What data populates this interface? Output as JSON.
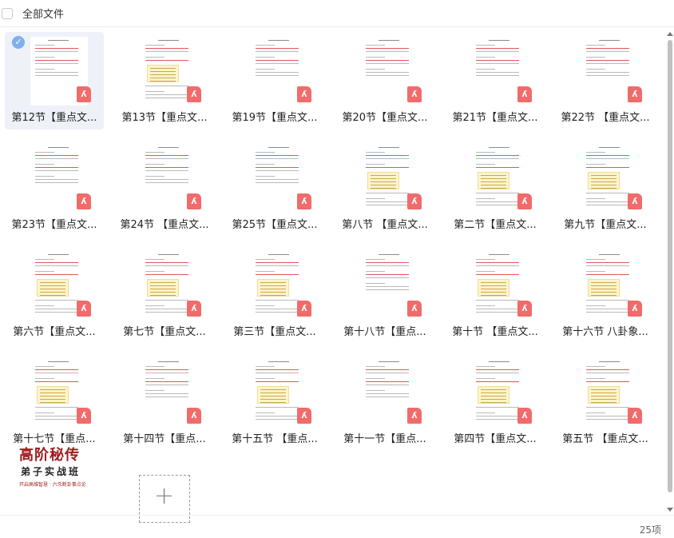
{
  "header": {
    "title": "全部文件"
  },
  "files": [
    {
      "label": "第12节【重点文...",
      "selected": true,
      "table": false
    },
    {
      "label": "第13节【重点文...",
      "selected": false,
      "table": true
    },
    {
      "label": "第19节【重点文...",
      "selected": false,
      "table": false
    },
    {
      "label": "第20节【重点文...",
      "selected": false,
      "table": false
    },
    {
      "label": "第21节【重点文...",
      "selected": false,
      "table": false
    },
    {
      "label": "第22节 【重点文...",
      "selected": false,
      "table": false
    },
    {
      "label": "第23节【重点文...",
      "selected": false,
      "table": false
    },
    {
      "label": "第24节 【重点文...",
      "selected": false,
      "table": false
    },
    {
      "label": "第25节【重点文...",
      "selected": false,
      "table": false
    },
    {
      "label": "第八节 【重点文...",
      "selected": false,
      "table": true
    },
    {
      "label": "第二节【重点文...",
      "selected": false,
      "table": true
    },
    {
      "label": "第九节【重点文...",
      "selected": false,
      "table": true
    },
    {
      "label": "第六节【重点文...",
      "selected": false,
      "table": true
    },
    {
      "label": "第七节【重点文...",
      "selected": false,
      "table": true
    },
    {
      "label": "第三节【重点文...",
      "selected": false,
      "table": true
    },
    {
      "label": "第十八节【重点...",
      "selected": false,
      "table": false
    },
    {
      "label": "第十节 【重点文...",
      "selected": false,
      "table": true
    },
    {
      "label": "第十六节 八卦象...",
      "selected": false,
      "table": true
    },
    {
      "label": "第十七节【重点...",
      "selected": false,
      "table": true
    },
    {
      "label": "第十四节【重点...",
      "selected": false,
      "table": false
    },
    {
      "label": "第十五节 【重点...",
      "selected": false,
      "table": true
    },
    {
      "label": "第十一节【重点...",
      "selected": false,
      "table": false
    },
    {
      "label": "第四节【重点文...",
      "selected": false,
      "table": true
    },
    {
      "label": "第五节 【重点文...",
      "selected": false,
      "table": true
    }
  ],
  "ad": {
    "title": "高阶秘传",
    "subtitle": "弟子实战班",
    "tagline": "开启高维智慧 · 六爻断卦事点论"
  },
  "icons": {
    "pdf": "pdf-icon",
    "check": "check-icon",
    "add": "plus-icon"
  },
  "footer": {
    "count": "25项"
  },
  "colors": {
    "pdf": "#f16b6b",
    "selected_bg": "#eef1f8",
    "check": "#7fb1ec",
    "ad_red": "#9c1c1c"
  }
}
